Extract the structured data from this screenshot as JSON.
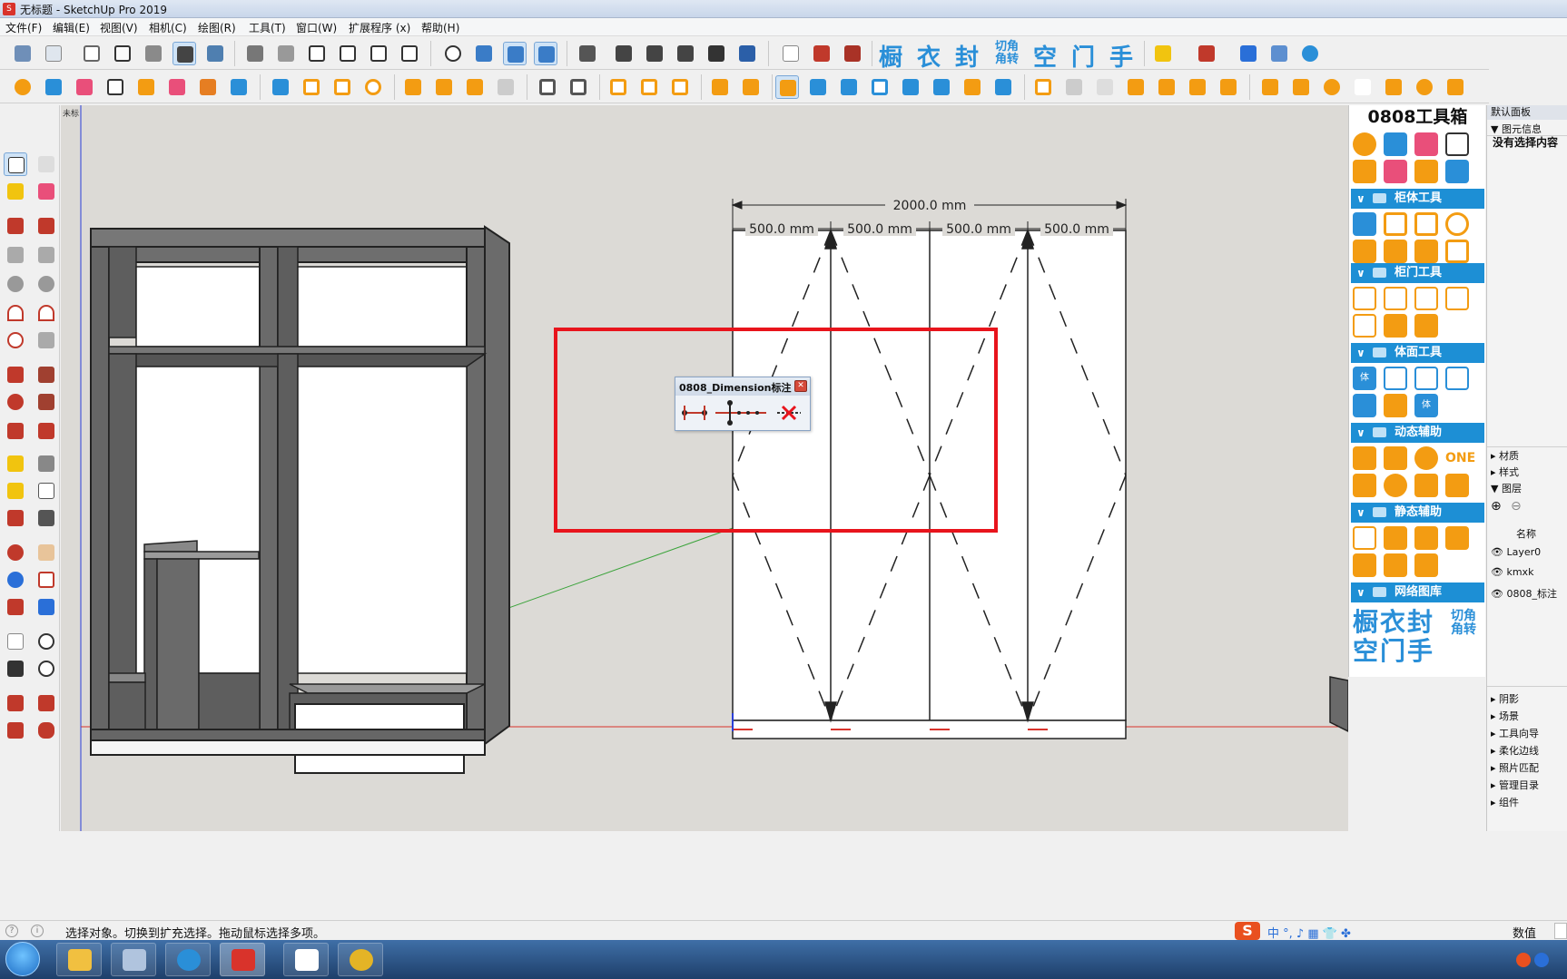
{
  "window": {
    "title": "无标题 - SketchUp Pro 2019",
    "app_icon_glyph": "S"
  },
  "menubar": {
    "items": [
      "文件(F)",
      "编辑(E)",
      "视图(V)",
      "相机(C)",
      "绘图(R)",
      "工具(T)",
      "窗口(W)",
      "扩展程序 (x)",
      "帮助(H)"
    ]
  },
  "toolbar1": {
    "big_chars": [
      "橱",
      "衣",
      "封",
      "空",
      "门",
      "手"
    ],
    "small_chars": [
      "切角",
      "角转"
    ]
  },
  "viewport": {
    "scene_tab": "未标",
    "dimensions": {
      "overall": "2000.0 mm",
      "segments": [
        "500.0 mm",
        "500.0 mm",
        "500.0 mm",
        "500.0 mm"
      ]
    },
    "colors": {
      "selection_box": "#e8141c",
      "axis_red": "#d9332b",
      "axis_green": "#3aa33a",
      "axis_blue": "#2a3fd8"
    }
  },
  "dimension_toolbar": {
    "title": "0808_Dimension标注",
    "close_glyph": "✕"
  },
  "toolbox": {
    "title": "0808工具箱",
    "sections": [
      "柜体工具",
      "柜门工具",
      "体面工具",
      "动态辅助",
      "静态辅助",
      "网络图库"
    ],
    "network_chars_row1": [
      "橱",
      "衣",
      "封"
    ],
    "network_chars_small": [
      "切角",
      "角转"
    ],
    "network_chars_row2": [
      "空",
      "门",
      "手"
    ],
    "one_label": "ONE",
    "panel_char": "体"
  },
  "right_panel": {
    "tray_title": "默认面板",
    "entity_info": "图元信息",
    "no_selection": "没有选择内容",
    "sections_mid": [
      "材质",
      "样式",
      "图层"
    ],
    "layers_header": "名称",
    "layers": [
      "Layer0",
      "kmxk",
      "0808_标注"
    ],
    "sections_bottom": [
      "阴影",
      "场景",
      "工具向导",
      "柔化边线",
      "照片匹配",
      "管理目录",
      "组件"
    ]
  },
  "statusbar": {
    "message": "选择对象。切换到扩充选择。拖动鼠标选择多项。",
    "ime_label": "S",
    "ime_text": "中 °, ♪ ▦ 👕 ✤",
    "value_label": "数值"
  },
  "taskbar": {
    "apps": [
      "file-explorer",
      "calculator",
      "browser",
      "sketchup",
      "youku",
      "chrome"
    ]
  }
}
